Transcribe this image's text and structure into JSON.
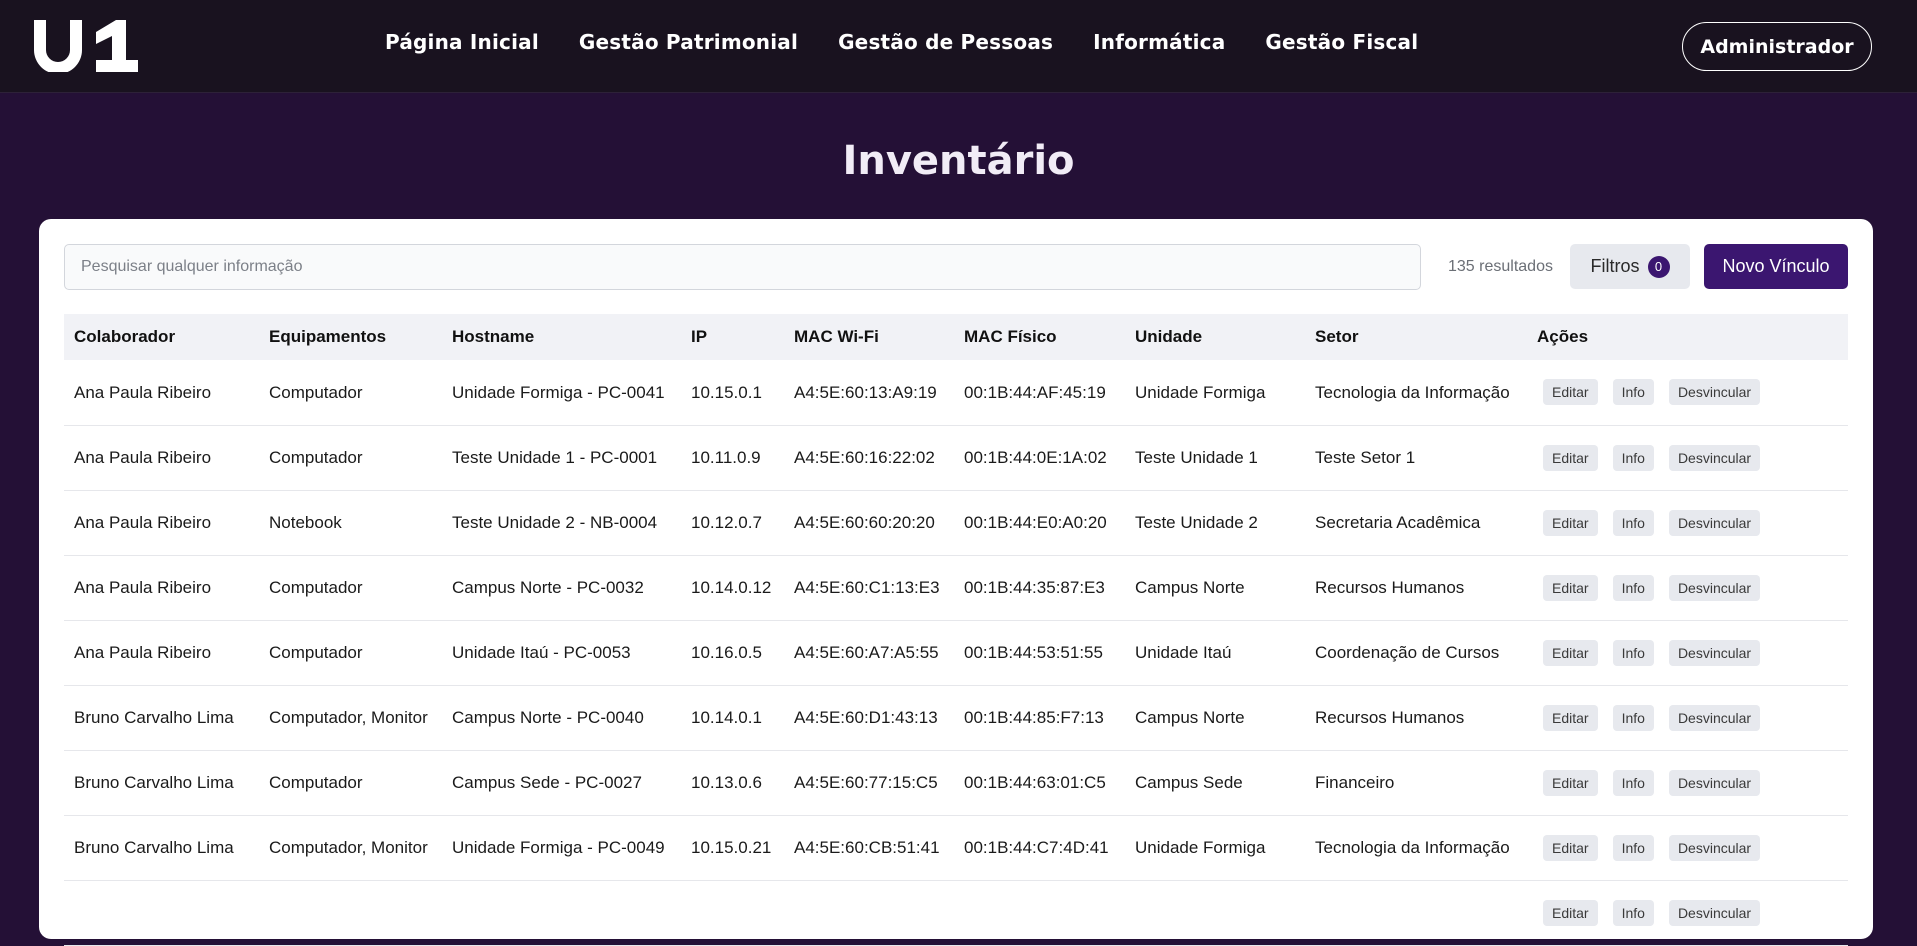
{
  "header": {
    "logo_text": "u1",
    "nav": [
      {
        "label": "Página Inicial"
      },
      {
        "label": "Gestão Patrimonial"
      },
      {
        "label": "Gestão de Pessoas"
      },
      {
        "label": "Informática"
      },
      {
        "label": "Gestão Fiscal"
      }
    ],
    "user_button": "Administrador"
  },
  "page": {
    "title": "Inventário"
  },
  "toolbar": {
    "search_placeholder": "Pesquisar qualquer informação",
    "results_text": "135 resultados",
    "filters_label": "Filtros",
    "filters_count": "0",
    "new_button": "Novo Vínculo"
  },
  "table": {
    "columns": [
      "Colaborador",
      "Equipamentos",
      "Hostname",
      "IP",
      "MAC Wi-Fi",
      "MAC Físico",
      "Unidade",
      "Setor",
      "Ações"
    ],
    "actions": {
      "edit": "Editar",
      "info": "Info",
      "unlink": "Desvincular"
    },
    "rows": [
      {
        "colaborador": "Ana Paula Ribeiro",
        "equipamentos": "Computador",
        "hostname": "Unidade Formiga - PC-0041",
        "ip": "10.15.0.1",
        "mac_wifi": "A4:5E:60:13:A9:19",
        "mac_fisico": "00:1B:44:AF:45:19",
        "unidade": "Unidade Formiga",
        "setor": "Tecnologia da Informação"
      },
      {
        "colaborador": "Ana Paula Ribeiro",
        "equipamentos": "Computador",
        "hostname": "Teste Unidade 1 - PC-0001",
        "ip": "10.11.0.9",
        "mac_wifi": "A4:5E:60:16:22:02",
        "mac_fisico": "00:1B:44:0E:1A:02",
        "unidade": "Teste Unidade 1",
        "setor": "Teste Setor 1"
      },
      {
        "colaborador": "Ana Paula Ribeiro",
        "equipamentos": "Notebook",
        "hostname": "Teste Unidade 2 - NB-0004",
        "ip": "10.12.0.7",
        "mac_wifi": "A4:5E:60:60:20:20",
        "mac_fisico": "00:1B:44:E0:A0:20",
        "unidade": "Teste Unidade 2",
        "setor": "Secretaria Acadêmica"
      },
      {
        "colaborador": "Ana Paula Ribeiro",
        "equipamentos": "Computador",
        "hostname": "Campus Norte - PC-0032",
        "ip": "10.14.0.12",
        "mac_wifi": "A4:5E:60:C1:13:E3",
        "mac_fisico": "00:1B:44:35:87:E3",
        "unidade": "Campus Norte",
        "setor": "Recursos Humanos"
      },
      {
        "colaborador": "Ana Paula Ribeiro",
        "equipamentos": "Computador",
        "hostname": "Unidade Itaú - PC-0053",
        "ip": "10.16.0.5",
        "mac_wifi": "A4:5E:60:A7:A5:55",
        "mac_fisico": "00:1B:44:53:51:55",
        "unidade": "Unidade Itaú",
        "setor": "Coordenação de Cursos"
      },
      {
        "colaborador": "Bruno Carvalho Lima",
        "equipamentos": "Computador, Monitor",
        "hostname": "Campus Norte - PC-0040",
        "ip": "10.14.0.1",
        "mac_wifi": "A4:5E:60:D1:43:13",
        "mac_fisico": "00:1B:44:85:F7:13",
        "unidade": "Campus Norte",
        "setor": "Recursos Humanos"
      },
      {
        "colaborador": "Bruno Carvalho Lima",
        "equipamentos": "Computador",
        "hostname": "Campus Sede - PC-0027",
        "ip": "10.13.0.6",
        "mac_wifi": "A4:5E:60:77:15:C5",
        "mac_fisico": "00:1B:44:63:01:C5",
        "unidade": "Campus Sede",
        "setor": "Financeiro"
      },
      {
        "colaborador": "Bruno Carvalho Lima",
        "equipamentos": "Computador, Monitor",
        "hostname": "Unidade Formiga - PC-0049",
        "ip": "10.15.0.21",
        "mac_wifi": "A4:5E:60:CB:51:41",
        "mac_fisico": "00:1B:44:C7:4D:41",
        "unidade": "Unidade Formiga",
        "setor": "Tecnologia da Informação"
      },
      {
        "colaborador": "",
        "equipamentos": "",
        "hostname": "",
        "ip": "",
        "mac_wifi": "",
        "mac_fisico": "",
        "unidade": "",
        "setor": ""
      }
    ]
  },
  "colors": {
    "page_bg": "#241036",
    "topbar_bg": "#19121f",
    "accent": "#3b1670",
    "button_gray": "#e7e9ee"
  }
}
